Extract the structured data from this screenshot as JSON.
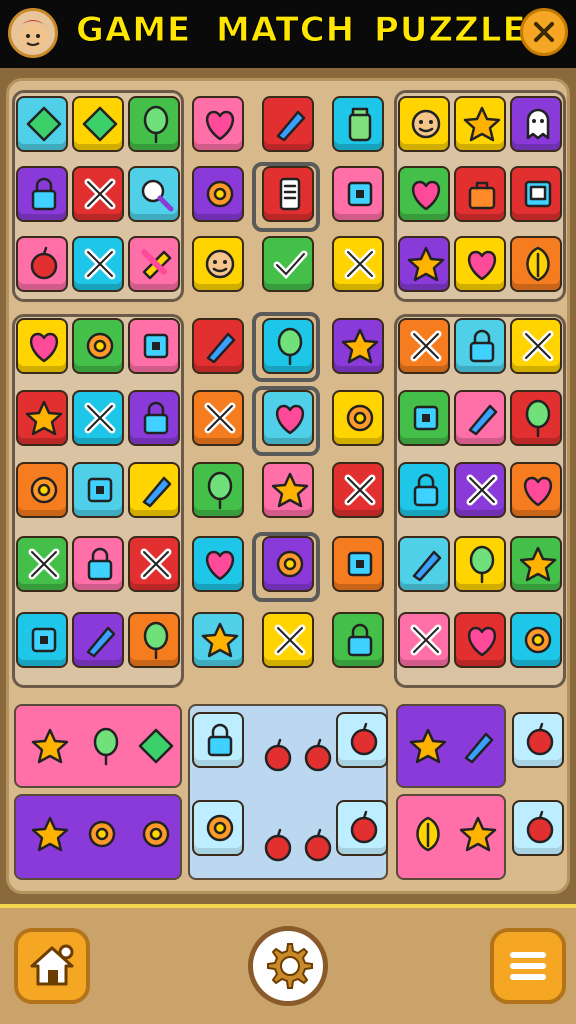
{
  "header": {
    "title_words": [
      "GAME",
      "MATCH",
      "PUZZLE"
    ]
  },
  "icons": {
    "avatar": "character-avatar-icon",
    "close": "close-icon",
    "home": "home-icon",
    "settings": "gear-icon",
    "menu": "menu-icon"
  },
  "colors": {
    "title": "#ffe600",
    "accent_button": "#f5a623",
    "board": "#d7b98c"
  },
  "board": {
    "tiles": [
      {
        "c": "#4fd0e8",
        "i": "diamond-icon"
      },
      {
        "c": "#ffd400",
        "i": "diamond-icon"
      },
      {
        "c": "#44c04a",
        "i": "balloon-icon"
      },
      {
        "c": "#ff6fa8",
        "i": "heart-icon"
      },
      {
        "c": "#e23030",
        "i": "brush-icon"
      },
      {
        "c": "#1ec6e8",
        "i": "jar-icon"
      },
      {
        "c": "#ffd400",
        "i": "face-icon"
      },
      {
        "c": "#ffd400",
        "i": "star-icon"
      },
      {
        "c": "#8a3ad8",
        "i": "ghost-icon"
      },
      {
        "c": "#8a3ad8",
        "i": "lock-icon"
      },
      {
        "c": "#e23030",
        "i": "cross-icon"
      },
      {
        "c": "#4fd0e8",
        "i": "magnifier-icon"
      },
      {
        "c": "#8a3ad8",
        "i": "flower-icon"
      },
      {
        "c": "#e23030",
        "i": "phone-icon"
      },
      {
        "c": "#ff6fa8",
        "i": "box-icon"
      },
      {
        "c": "#44c04a",
        "i": "heart-icon"
      },
      {
        "c": "#e23030",
        "i": "bag-icon"
      },
      {
        "c": "#e23030",
        "i": "screen-icon"
      },
      {
        "c": "#ff6fa8",
        "i": "apple-icon"
      },
      {
        "c": "#1ec6e8",
        "i": "cross-icon"
      },
      {
        "c": "#ff6fa8",
        "i": "bandage-icon"
      },
      {
        "c": "#ffd400",
        "i": "face-icon"
      },
      {
        "c": "#44c04a",
        "i": "check-icon"
      },
      {
        "c": "#ffd400",
        "i": "cross-icon"
      },
      {
        "c": "#8a3ad8",
        "i": "star-icon"
      },
      {
        "c": "#ffd400",
        "i": "heart-icon"
      },
      {
        "c": "#f57c1f",
        "i": "leaf-icon"
      }
    ]
  }
}
